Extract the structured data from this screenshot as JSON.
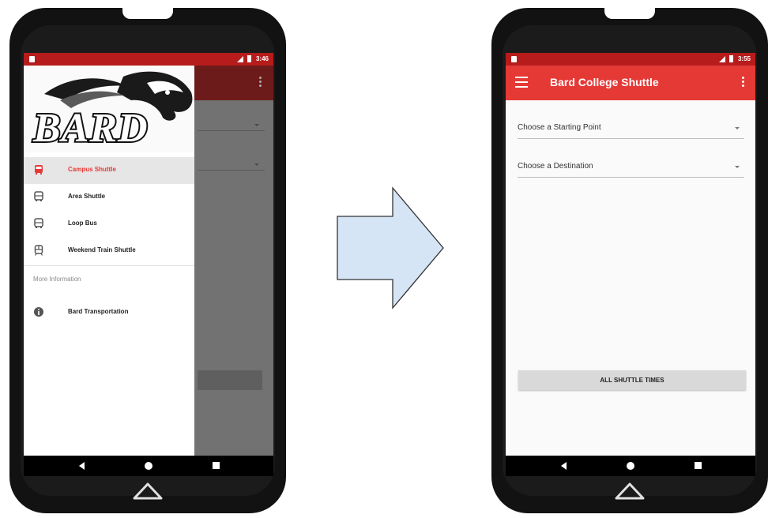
{
  "left_phone": {
    "status_time": "3:46",
    "logo_text": "BARD",
    "drawer": {
      "items": [
        {
          "label": "Campus Shuttle",
          "icon": "bus-icon",
          "active": true
        },
        {
          "label": "Area Shuttle",
          "icon": "bus-icon",
          "active": false
        },
        {
          "label": "Loop Bus",
          "icon": "bus-icon",
          "active": false
        },
        {
          "label": "Weekend Train Shuttle",
          "icon": "train-icon",
          "active": false
        }
      ],
      "section_label": "More Information",
      "info_item": {
        "label": "Bard Transportation",
        "icon": "info-icon"
      }
    }
  },
  "right_phone": {
    "status_time": "3:55",
    "app_title": "Bard College Shuttle",
    "start_dropdown": "Choose a Starting Point",
    "destination_dropdown": "Choose a Destination",
    "all_times_button": "ALL SHUTTLE TIMES"
  },
  "colors": {
    "accent": "#e53935",
    "status_bar": "#b71c1c",
    "arrow_fill": "#d5e5f5",
    "arrow_stroke": "#333333"
  }
}
